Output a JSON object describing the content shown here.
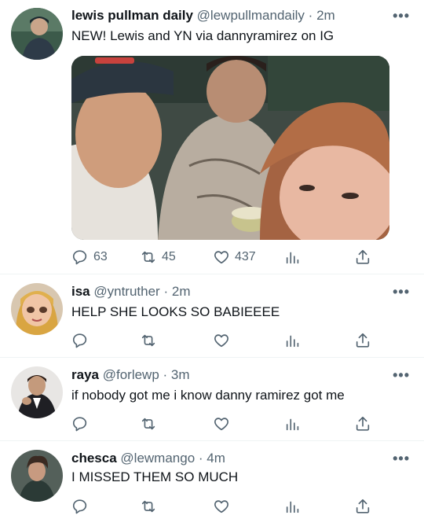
{
  "tweets": [
    {
      "name": "lewis pullman daily",
      "handle": "@lewpullmandaily",
      "sep": "·",
      "time": "2m",
      "text": "NEW! Lewis and YN via dannyramirez on IG",
      "reply_count": "63",
      "retweet_count": "45",
      "like_count": "437",
      "avatar_icon": "dark-portrait"
    },
    {
      "name": "isa",
      "handle": "@yntruther",
      "sep": "·",
      "time": "2m",
      "text": "HELP SHE LOOKS SO BABIEEEE",
      "avatar_icon": "animated-character"
    },
    {
      "name": "raya",
      "handle": "@forlewp",
      "sep": "·",
      "time": "3m",
      "text": "if nobody got me i know danny ramirez got me",
      "avatar_icon": "man-in-suit"
    },
    {
      "name": "chesca",
      "handle": "@lewmango",
      "sep": "·",
      "time": "4m",
      "text": "I MISSED THEM SO MUCH",
      "avatar_icon": "curly-hair-portrait"
    }
  ],
  "more_label": "•••",
  "colors": {
    "text": "#0f1419",
    "secondary": "#536471",
    "divider": "#eff3f4"
  }
}
